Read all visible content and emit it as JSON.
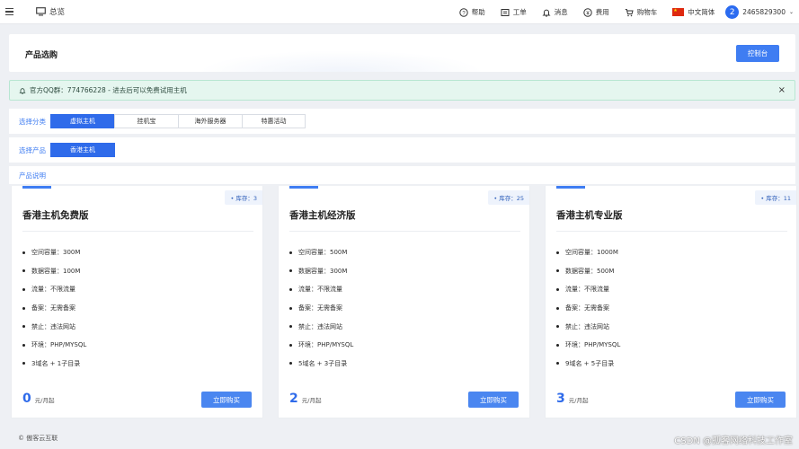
{
  "topbar": {
    "overview_label": "总览",
    "nav": [
      {
        "icon": "help-icon",
        "label": "帮助"
      },
      {
        "icon": "ticket-icon",
        "label": "工单"
      },
      {
        "icon": "bell-icon",
        "label": "消息"
      },
      {
        "icon": "yuan-icon",
        "label": "费用"
      },
      {
        "icon": "cart-icon",
        "label": "购物车"
      }
    ],
    "language": "中文简体",
    "avatar_text": "2",
    "user_id": "2465829300"
  },
  "header": {
    "title": "产品选购",
    "console_button": "控制台"
  },
  "alert": {
    "text": "官方QQ群：774766228 - 进去后可以免费试用主机",
    "close": "×"
  },
  "category": {
    "label": "选择分类",
    "tabs": [
      "虚拟主机",
      "挂机宝",
      "海外服务器",
      "特惠活动"
    ],
    "active": 0
  },
  "product": {
    "label": "选择产品",
    "tabs": [
      "香港主机"
    ],
    "active": 0
  },
  "description": {
    "label": "产品说明"
  },
  "cards": [
    {
      "stock": "• 库存：3",
      "title": "香港主机免费版",
      "specs": [
        "空间容量：300M",
        "数据容量：100M",
        "流量：不限流量",
        "备案：无需备案",
        "禁止：违法网站",
        "环境：PHP/MYSQL",
        "3域名 + 1子目录"
      ],
      "price": "0",
      "unit": "元/月起",
      "buy": "立即购买"
    },
    {
      "stock": "• 库存：25",
      "title": "香港主机经济版",
      "specs": [
        "空间容量：500M",
        "数据容量：300M",
        "流量：不限流量",
        "备案：无需备案",
        "禁止：违法网站",
        "环境：PHP/MYSQL",
        "5域名 + 3子目录"
      ],
      "price": "2",
      "unit": "元/月起",
      "buy": "立即购买"
    },
    {
      "stock": "• 库存：11",
      "title": "香港主机专业版",
      "specs": [
        "空间容量：1000M",
        "数据容量：500M",
        "流量：不限流量",
        "备案：无需备案",
        "禁止：违法网站",
        "环境：PHP/MYSQL",
        "9域名 + 5子目录"
      ],
      "price": "3",
      "unit": "元/月起",
      "buy": "立即购买"
    }
  ],
  "footer": "© 傲客云互联",
  "watermark": "CSDN @孤客网络科技工作室",
  "colors": {
    "accent": "#3f7df2",
    "alert_bg": "#e5f6ef",
    "page_bg": "#eef0f4"
  }
}
